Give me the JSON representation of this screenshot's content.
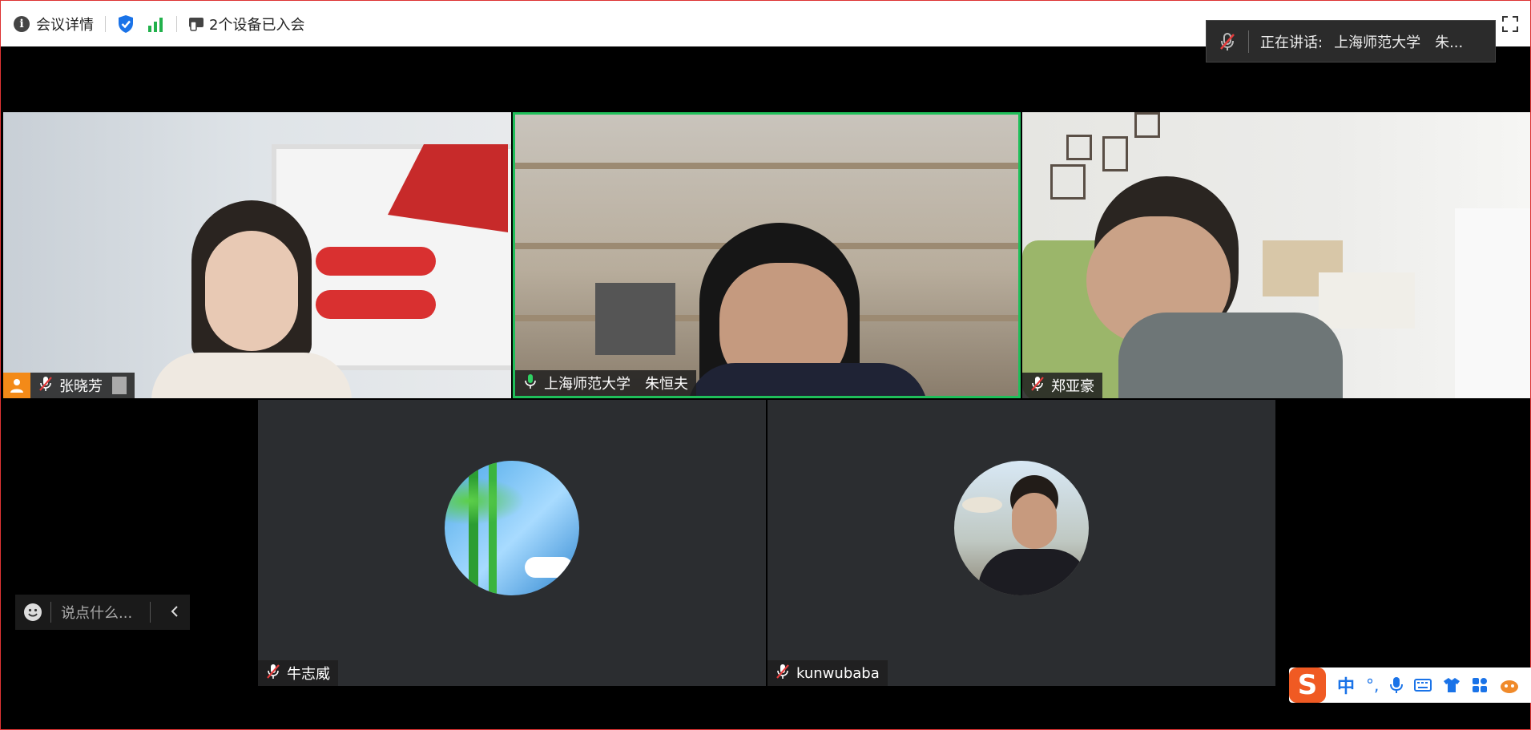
{
  "topbar": {
    "meeting_details": "会议详情",
    "devices_joined": "2个设备已入会"
  },
  "speaking": {
    "label": "正在讲话:",
    "speaker": "上海师范大学　朱..."
  },
  "tiles": {
    "t1": {
      "name": "张晓芳"
    },
    "t2": {
      "name": "上海师范大学　朱恒夫"
    },
    "t3": {
      "name": "郑亚豪"
    },
    "t4": {
      "name": "牛志威"
    },
    "t5": {
      "name": "kunwubaba"
    }
  },
  "chat": {
    "placeholder": "说点什么..."
  },
  "ime": {
    "lang": "中",
    "punct": "°,"
  },
  "colors": {
    "active_border": "#1fbf5a",
    "host_badge": "#f38a18",
    "accent": "#1a73e8"
  }
}
